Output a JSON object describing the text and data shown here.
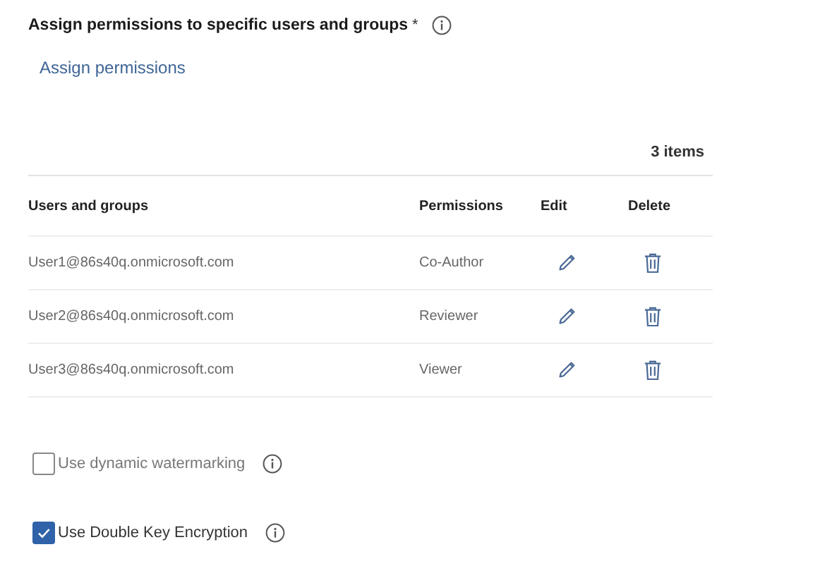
{
  "section": {
    "title": "Assign permissions to specific users and groups",
    "required_mark": "*"
  },
  "link": "Assign permissions",
  "item_count": "3 items",
  "table": {
    "columns": [
      "Users and groups",
      "Permissions",
      "Edit",
      "Delete"
    ],
    "rows": [
      {
        "user": "User1@86s40q.onmicrosoft.com",
        "permission": "Co-Author"
      },
      {
        "user": "User2@86s40q.onmicrosoft.com",
        "permission": "Reviewer"
      },
      {
        "user": "User3@86s40q.onmicrosoft.com",
        "permission": "Viewer"
      }
    ]
  },
  "options": [
    {
      "label": "Use dynamic watermarking",
      "checked": false
    },
    {
      "label": "Use Double Key Encryption",
      "checked": true
    }
  ]
}
